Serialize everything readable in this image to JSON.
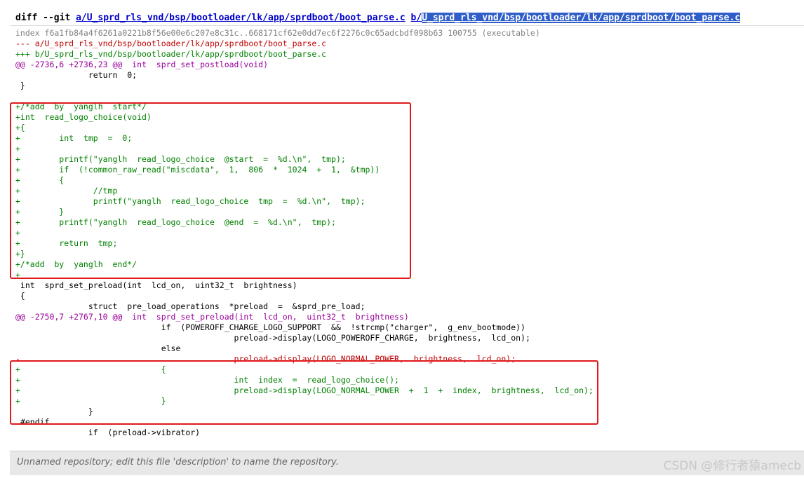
{
  "header": {
    "prefix": "diff --git ",
    "path_a": "a/U_sprd_rls_vnd/bsp/bootloader/lk/app/sprdboot/boot_parse.c",
    "path_b_prefix": "b/",
    "path_b": "U_sprd_rls_vnd/bsp/bootloader/lk/app/sprdboot/boot_parse.c"
  },
  "diff_lines": [
    {
      "type": "meta",
      "text": "index f6a1fb84a4f6261a0221b8f56e00e6c207e8c31c..668171cf62e0dd7ec6f2276c0c65adcbdf098b63 100755 (executable)"
    },
    {
      "type": "minus-file",
      "text": "--- a/U_sprd_rls_vnd/bsp/bootloader/lk/app/sprdboot/boot_parse.c"
    },
    {
      "type": "plus-file",
      "text": "+++ b/U_sprd_rls_vnd/bsp/bootloader/lk/app/sprdboot/boot_parse.c"
    },
    {
      "type": "chunk",
      "text": "@@ -2736,6 +2736,23 @@  int  sprd_set_postload(void)"
    },
    {
      "type": "ctx",
      "text": "               return  0;"
    },
    {
      "type": "ctx",
      "text": " }"
    },
    {
      "type": "ctx",
      "text": " "
    },
    {
      "type": "add",
      "text": "+/*add  by  yanglh  start*/"
    },
    {
      "type": "add",
      "text": "+int  read_logo_choice(void)"
    },
    {
      "type": "add",
      "text": "+{"
    },
    {
      "type": "add",
      "text": "+        int  tmp  =  0;"
    },
    {
      "type": "add",
      "text": "+"
    },
    {
      "type": "add",
      "text": "+        printf(\"yanglh  read_logo_choice  @start  =  %d.\\n\",  tmp);"
    },
    {
      "type": "add",
      "text": "+        if  (!common_raw_read(\"miscdata\",  1,  806  *  1024  +  1,  &tmp))"
    },
    {
      "type": "add",
      "text": "+        {"
    },
    {
      "type": "add",
      "text": "+               //tmp"
    },
    {
      "type": "add",
      "text": "+               printf(\"yanglh  read_logo_choice  tmp  =  %d.\\n\",  tmp);"
    },
    {
      "type": "add",
      "text": "+        }"
    },
    {
      "type": "add",
      "text": "+        printf(\"yanglh  read_logo_choice  @end  =  %d.\\n\",  tmp);"
    },
    {
      "type": "add",
      "text": "+"
    },
    {
      "type": "add",
      "text": "+        return  tmp;"
    },
    {
      "type": "add",
      "text": "+}"
    },
    {
      "type": "add",
      "text": "+/*add  by  yanglh  end*/"
    },
    {
      "type": "add",
      "text": "+"
    },
    {
      "type": "ctx",
      "text": " int  sprd_set_preload(int  lcd_on,  uint32_t  brightness)"
    },
    {
      "type": "ctx",
      "text": " {"
    },
    {
      "type": "ctx",
      "text": "               struct  pre_load_operations  *preload  =  &sprd_pre_load;"
    },
    {
      "type": "chunk",
      "text": "@@ -2750,7 +2767,10 @@  int  sprd_set_preload(int  lcd_on,  uint32_t  brightness)"
    },
    {
      "type": "ctx",
      "text": "                              if  (POWEROFF_CHARGE_LOGO_SUPPORT  &&  !strcmp(\"charger\",  g_env_bootmode))"
    },
    {
      "type": "ctx",
      "text": "                                             preload->display(LOGO_POWEROFF_CHARGE,  brightness,  lcd_on);"
    },
    {
      "type": "ctx",
      "text": "                              else"
    },
    {
      "type": "del",
      "text": "-                                            preload->display(LOGO_NORMAL_POWER,  brightness,  lcd_on);"
    },
    {
      "type": "add",
      "text": "+                             {"
    },
    {
      "type": "add",
      "text": "+                                            int  index  =  read_logo_choice();"
    },
    {
      "type": "add",
      "text": "+                                            preload->display(LOGO_NORMAL_POWER  +  1  +  index,  brightness,  lcd_on);"
    },
    {
      "type": "add",
      "text": "+                             }"
    },
    {
      "type": "ctx",
      "text": "               }"
    },
    {
      "type": "ctx",
      "text": " #endif"
    },
    {
      "type": "ctx",
      "text": "               if  (preload->vibrator)"
    }
  ],
  "footer": {
    "description": "Unnamed repository; edit this file 'description' to name the repository."
  },
  "watermark": "CSDN @修行者猿amecb",
  "colors": {
    "add": "#008000",
    "del": "#c00000",
    "chunk": "#990099",
    "meta": "#808080",
    "highlight_box": "#e0191b",
    "selection": "#2f5ec9"
  }
}
